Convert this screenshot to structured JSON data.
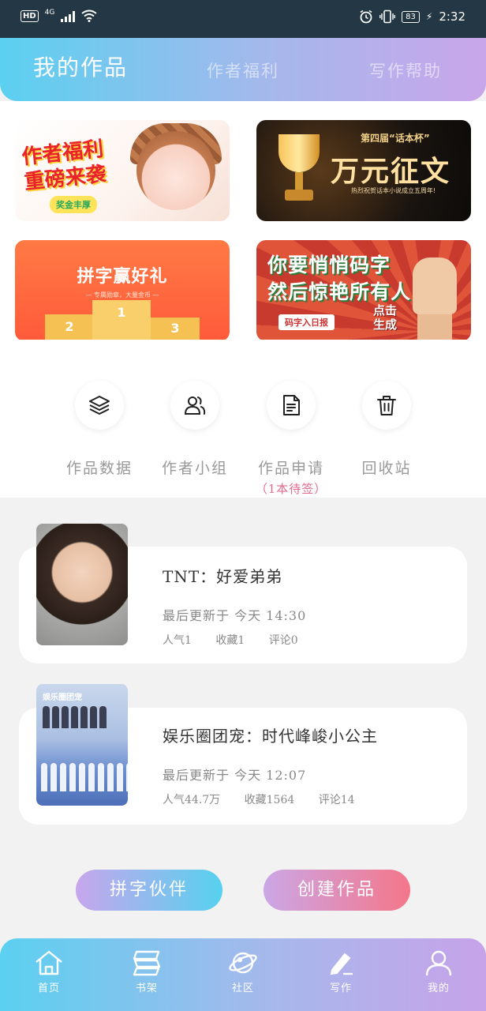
{
  "status_bar": {
    "hd": "HD",
    "network": "4G",
    "battery": "83",
    "time": "2:32"
  },
  "header": {
    "tabs": [
      {
        "label": "我的作品",
        "active": true
      },
      {
        "label": "作者福利",
        "active": false
      },
      {
        "label": "写作帮助",
        "active": false
      }
    ]
  },
  "banners": {
    "b1": {
      "title_line1": "作者福利",
      "title_line2": "重磅来袭",
      "badge": "奖金丰厚"
    },
    "b2": {
      "small": "第四届“话本杯”",
      "big": "万元征文",
      "sub": "热烈祝贺话本小说成立五周年!"
    },
    "b3": {
      "title": "拼字赢好礼",
      "sub": "— 专属勋章，大量金币 —",
      "places": [
        "1",
        "2",
        "3"
      ]
    },
    "b4": {
      "line1": "你要悄悄码字",
      "line2": "然后惊艳所有人",
      "tag": "码字入日报",
      "cta_line1": "点击",
      "cta_line2": "生成"
    }
  },
  "shortcuts": [
    {
      "label": "作品数据",
      "icon": "layers-icon"
    },
    {
      "label": "作者小组",
      "icon": "group-icon"
    },
    {
      "label": "作品申请",
      "icon": "document-icon",
      "sub": "（1本待签）"
    },
    {
      "label": "回收站",
      "icon": "trash-icon"
    }
  ],
  "works": [
    {
      "title": "TNT：好爱弟弟",
      "updated": "最后更新于 今天 14:30",
      "popularity": "人气1",
      "favorites": "收藏1",
      "comments": "评论0"
    },
    {
      "title": "娱乐圈团宠：时代峰峻小公主",
      "cover_text": "娱乐圈团宠",
      "updated": "最后更新于 今天 12:07",
      "popularity": "人气44.7万",
      "favorites": "收藏1564",
      "comments": "评论14"
    }
  ],
  "actions": {
    "partner": "拼字伙伴",
    "create": "创建作品"
  },
  "bottom_nav": [
    {
      "label": "首页",
      "icon": "home-icon"
    },
    {
      "label": "书架",
      "icon": "bookshelf-icon"
    },
    {
      "label": "社区",
      "icon": "planet-icon"
    },
    {
      "label": "写作",
      "icon": "pen-icon",
      "active": true
    },
    {
      "label": "我的",
      "icon": "user-icon"
    }
  ],
  "colors": {
    "gradient_start": "#5bd0f0",
    "gradient_end": "#c9a6ea",
    "pending_text": "#e36a8c",
    "create_button_end": "#f4768a"
  }
}
